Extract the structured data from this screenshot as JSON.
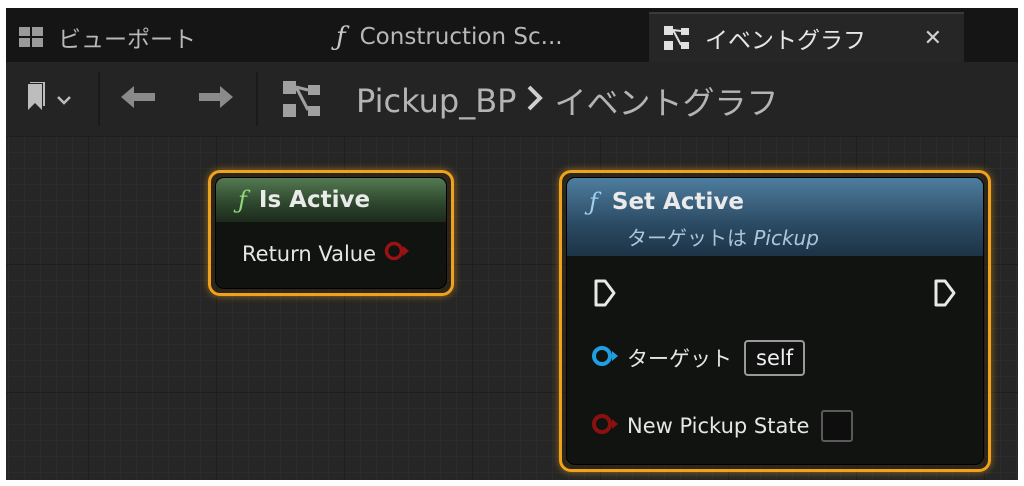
{
  "tabs": [
    {
      "label": "ビューポート",
      "icon": "viewport-grid-icon",
      "active": false
    },
    {
      "label": "Construction Sc...",
      "icon": "function-icon",
      "active": false
    },
    {
      "label": "イベントグラフ",
      "icon": "event-graph-icon",
      "active": true
    }
  ],
  "toolbar": {
    "breadcrumb": {
      "root": "Pickup_BP",
      "current": "イベントグラフ"
    }
  },
  "nodes": {
    "is_active": {
      "title": "Is Active",
      "output_label": "Return Value"
    },
    "set_active": {
      "title": "Set Active",
      "subtitle_prefix": "ターゲットは ",
      "subtitle_target": "Pickup",
      "target_label": "ターゲット",
      "target_value": "self",
      "state_label": "New Pickup State"
    }
  },
  "colors": {
    "selection": "#f0a21a",
    "pure_header": "#3d5c3b",
    "function_header": "#3a6482",
    "bool_pin": "#8b1010",
    "object_pin": "#1f9ee0",
    "exec_pin": "#ffffff"
  }
}
